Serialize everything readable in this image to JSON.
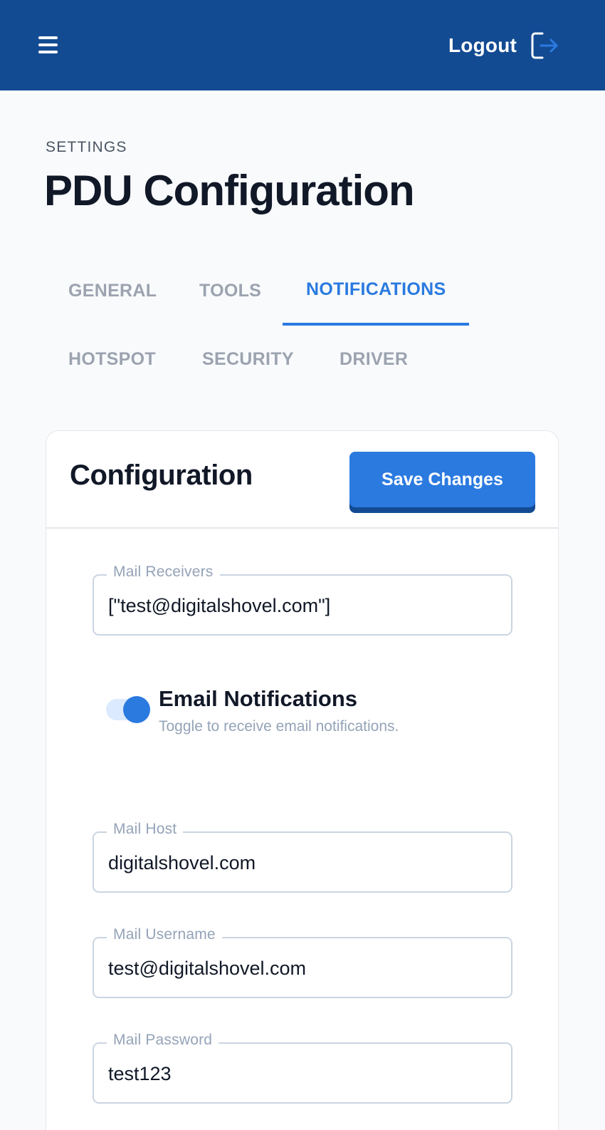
{
  "header": {
    "menu_icon": "hamburger-menu-icon",
    "logout_label": "Logout",
    "logout_icon": "logout-arrow-icon",
    "background": "#134b93",
    "icon_accent": "#2b7ae0"
  },
  "page": {
    "eyebrow": "SETTINGS",
    "title": "PDU Configuration"
  },
  "tabs": [
    {
      "label": "GENERAL",
      "active": false
    },
    {
      "label": "TOOLS",
      "active": false
    },
    {
      "label": "NOTIFICATIONS",
      "active": true
    },
    {
      "label": "HOTSPOT",
      "active": false
    },
    {
      "label": "SECURITY",
      "active": false
    },
    {
      "label": "DRIVER",
      "active": false
    }
  ],
  "card": {
    "title": "Configuration",
    "save_label": "Save Changes",
    "fields": {
      "mail_receivers": {
        "label": "Mail Receivers",
        "value": "[\"test@digitalshovel.com\"]"
      },
      "mail_host": {
        "label": "Mail Host",
        "value": "digitalshovel.com"
      },
      "mail_username": {
        "label": "Mail Username",
        "value": "test@digitalshovel.com"
      },
      "mail_password": {
        "label": "Mail Password",
        "value": "test123"
      }
    },
    "email_notifications": {
      "title": "Email Notifications",
      "hint": "Toggle to receive email notifications.",
      "enabled": true
    }
  },
  "colors": {
    "accent": "#2b7ae0",
    "brand_dark": "#134b93",
    "muted": "#9ca3af"
  }
}
